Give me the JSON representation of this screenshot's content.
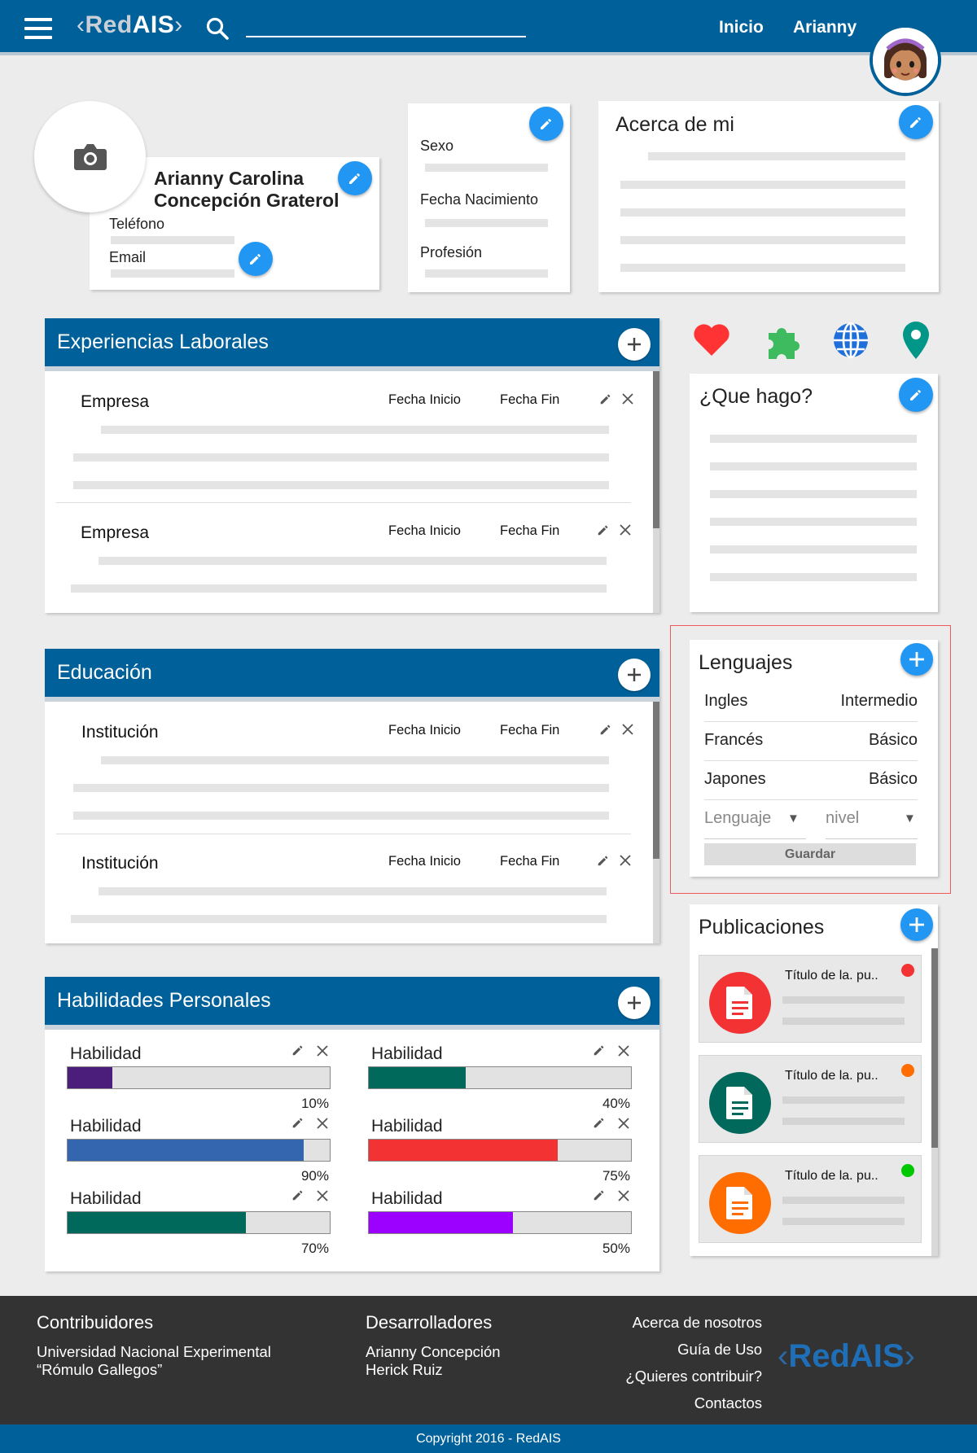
{
  "header": {
    "logo_open": "‹",
    "logo_red": "Red",
    "logo_ais": "AIS",
    "logo_close": "›",
    "search_value": "",
    "nav": [
      "Inicio",
      "Arianny"
    ]
  },
  "profile": {
    "name_line1": "Arianny Carolina",
    "name_line2": "Concepción Graterol",
    "phone_label": "Teléfono",
    "email_label": "Email"
  },
  "personal": {
    "sex_label": "Sexo",
    "birth_label": "Fecha Nacimiento",
    "profession_label": "Profesión"
  },
  "about": {
    "title": "Acerca de mi"
  },
  "experience": {
    "title": "Experiencias Laborales",
    "rows": [
      {
        "name": "Empresa",
        "start": "Fecha Inicio",
        "end": "Fecha Fin"
      },
      {
        "name": "Empresa",
        "start": "Fecha Inicio",
        "end": "Fecha Fin"
      }
    ]
  },
  "education": {
    "title": "Educación",
    "rows": [
      {
        "name": "Institución",
        "start": "Fecha Inicio",
        "end": "Fecha Fin"
      },
      {
        "name": "Institución",
        "start": "Fecha Inicio",
        "end": "Fecha Fin"
      }
    ]
  },
  "skills": {
    "title": "Habilidades Personales",
    "items": [
      {
        "label": "Habilidad",
        "percent_text": "10%",
        "level": 0.17,
        "color": "#4a1e7a"
      },
      {
        "label": "Habilidad",
        "percent_text": "40%",
        "level": 0.37,
        "color": "#00695c"
      },
      {
        "label": "Habilidad",
        "percent_text": "90%",
        "level": 0.9,
        "color": "#3466b0"
      },
      {
        "label": "Habilidad",
        "percent_text": "75%",
        "level": 0.72,
        "color": "#f33333"
      },
      {
        "label": "Habilidad",
        "percent_text": "70%",
        "level": 0.68,
        "color": "#00695c"
      },
      {
        "label": "Habilidad",
        "percent_text": "50%",
        "level": 0.55,
        "color": "#9c00ff"
      }
    ]
  },
  "icons_row": [
    "heart-icon",
    "puzzle-icon",
    "globe-icon",
    "location-pin-icon"
  ],
  "what_i_do": {
    "title": "¿Que hago?"
  },
  "languages": {
    "title": "Lenguajes",
    "rows": [
      {
        "name": "Ingles",
        "level": "Intermedio"
      },
      {
        "name": "Francés",
        "level": "Básico"
      },
      {
        "name": "Japones",
        "level": "Básico"
      }
    ],
    "select_language": "Lenguaje",
    "select_level": "nivel",
    "save_label": "Guardar"
  },
  "publications": {
    "title": "Publicaciones",
    "items": [
      {
        "title": "Título de la. pu..",
        "color": "#f33333",
        "status_color": "#f33333"
      },
      {
        "title": "Título de la. pu..",
        "color": "#00695c",
        "status_color": "#ff6d00"
      },
      {
        "title": "Título de la. pu..",
        "color": "#ff6d00",
        "status_color": "#00c800"
      }
    ]
  },
  "footer": {
    "contrib_title": "Contribuidores",
    "contrib_line1": "Universidad Nacional Experimental",
    "contrib_line2": "“Rómulo Gallegos”",
    "dev_title": "Desarrolladores",
    "dev_line1": "Arianny Concepción",
    "dev_line2": "Herick Ruiz",
    "links": [
      "Acerca de nosotros",
      "Guía de Uso",
      "¿Quieres contribuir?",
      "Contactos"
    ],
    "logo_open": "‹",
    "logo_text": "RedAIS",
    "logo_close": "›"
  },
  "copyright": "Copyright 2016 - RedAIS",
  "colors": {
    "primary": "#00609a",
    "accent": "#2196f3",
    "footer": "#333333"
  }
}
